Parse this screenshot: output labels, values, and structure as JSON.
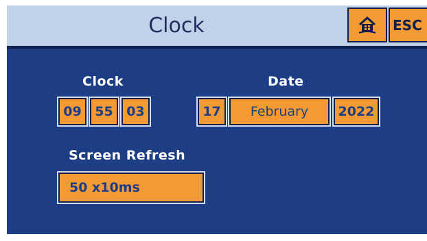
{
  "header": {
    "title": "Clock",
    "home_icon": "home-icon",
    "esc_label": "ESC"
  },
  "labels": {
    "clock": "Clock",
    "date": "Date",
    "screen_refresh": "Screen Refresh"
  },
  "clock": {
    "hours": "09",
    "minutes": "55",
    "seconds": "03"
  },
  "date": {
    "day": "17",
    "month": "February",
    "year": "2022"
  },
  "screen_refresh": {
    "value": "50 x10ms"
  },
  "colors": {
    "background": "#1d3e84",
    "header": "#c2d1ea",
    "field": "#f49a35",
    "field_text": "#1d3e84",
    "label_text": "#ffffff"
  }
}
